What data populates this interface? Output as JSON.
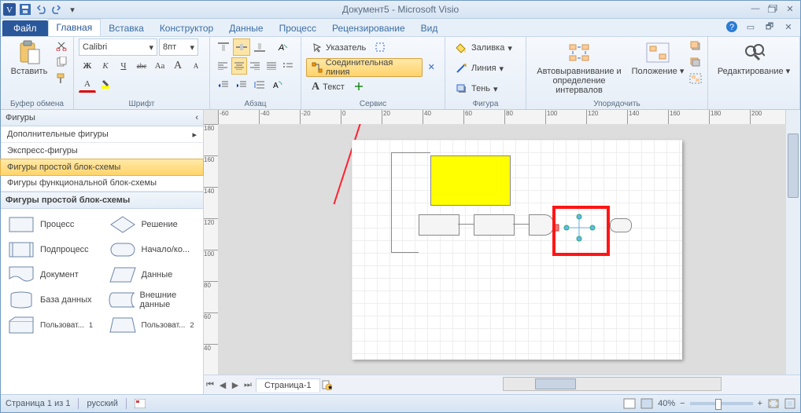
{
  "title": "Документ5 - Microsoft Visio",
  "tabs": {
    "file": "Файл",
    "home": "Главная",
    "insert": "Вставка",
    "design": "Конструктор",
    "data": "Данные",
    "process": "Процесс",
    "review": "Рецензирование",
    "view": "Вид"
  },
  "ribbon": {
    "clipboard": {
      "label": "Буфер обмена",
      "paste": "Вставить"
    },
    "font": {
      "label": "Шрифт",
      "name": "Calibri",
      "size": "8пт",
      "bold": "Ж",
      "italic": "К",
      "underline": "Ч",
      "strike": "abc",
      "case": "Aa",
      "grow": "A",
      "shrink": "A",
      "colorA": "A"
    },
    "para": {
      "label": "Абзац"
    },
    "tools": {
      "label": "Сервис",
      "pointer": "Указатель",
      "connector": "Соединительная линия",
      "text": "Текст",
      "x": "✕"
    },
    "shape": {
      "label": "Фигура",
      "fill": "Заливка",
      "line": "Линия",
      "shadow": "Тень"
    },
    "arrange": {
      "label": "Упорядочить",
      "auto": "Автовыравнивание и определение интервалов",
      "position": "Положение"
    },
    "editing": {
      "label": "Редактирование"
    }
  },
  "shapes": {
    "title": "Фигуры",
    "more": "Дополнительные фигуры",
    "quick": "Экспресс-фигуры",
    "basic": "Фигуры простой блок-схемы",
    "func": "Фигуры функциональной блок-схемы",
    "stencilTitle": "Фигуры простой блок-схемы",
    "items": [
      {
        "l": "Процесс"
      },
      {
        "l": "Решение"
      },
      {
        "l": "Подпроцесс"
      },
      {
        "l": "Начало/ко..."
      },
      {
        "l": "Документ"
      },
      {
        "l": "Данные"
      },
      {
        "l": "База данных"
      },
      {
        "l": "Внешние данные"
      },
      {
        "l": "Пользоват..."
      },
      {
        "l": "Пользоват..."
      }
    ]
  },
  "ruler": {
    "h": [
      "-60",
      "-40",
      "-20",
      "0",
      "20",
      "40",
      "60",
      "80",
      "100",
      "120",
      "140",
      "160",
      "180",
      "200"
    ],
    "v": [
      "180",
      "160",
      "140",
      "120",
      "100",
      "80",
      "60",
      "40"
    ]
  },
  "pageTab": "Страница-1",
  "status": {
    "page": "Страница 1 из 1",
    "lang": "русский",
    "zoom": "40%"
  }
}
